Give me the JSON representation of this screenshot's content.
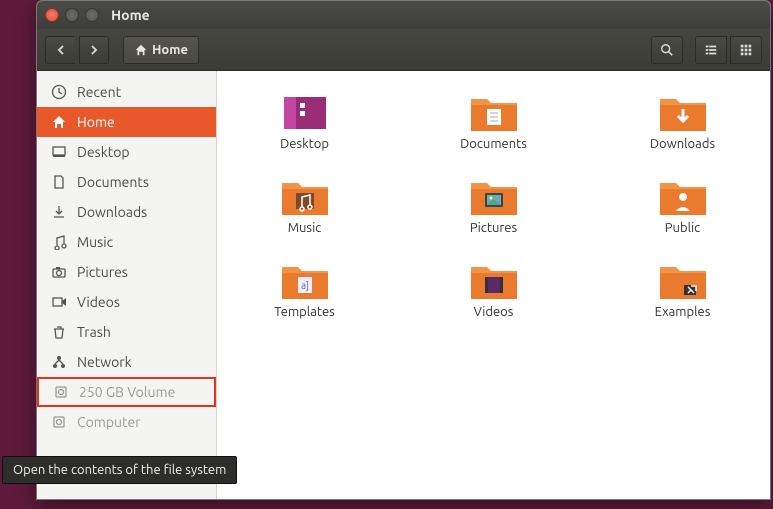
{
  "window": {
    "title": "Home"
  },
  "toolbar": {
    "path_label": "Home"
  },
  "sidebar": {
    "items": [
      {
        "label": "Recent",
        "icon": "clock"
      },
      {
        "label": "Home",
        "icon": "home"
      },
      {
        "label": "Desktop",
        "icon": "desktop"
      },
      {
        "label": "Documents",
        "icon": "doc"
      },
      {
        "label": "Downloads",
        "icon": "download"
      },
      {
        "label": "Music",
        "icon": "music"
      },
      {
        "label": "Pictures",
        "icon": "camera"
      },
      {
        "label": "Videos",
        "icon": "video"
      },
      {
        "label": "Trash",
        "icon": "trash"
      },
      {
        "label": "Network",
        "icon": "network"
      },
      {
        "label": "250 GB Volume",
        "icon": "disk"
      },
      {
        "label": "Computer",
        "icon": "disk"
      }
    ]
  },
  "files": [
    {
      "label": "Desktop",
      "variant": "purple"
    },
    {
      "label": "Documents",
      "variant": "docs"
    },
    {
      "label": "Downloads",
      "variant": "download"
    },
    {
      "label": "Music",
      "variant": "music"
    },
    {
      "label": "Pictures",
      "variant": "pictures"
    },
    {
      "label": "Public",
      "variant": "public"
    },
    {
      "label": "Templates",
      "variant": "templates"
    },
    {
      "label": "Videos",
      "variant": "videos"
    },
    {
      "label": "Examples",
      "variant": "examples"
    }
  ],
  "tooltip": "Open the contents of the file system"
}
